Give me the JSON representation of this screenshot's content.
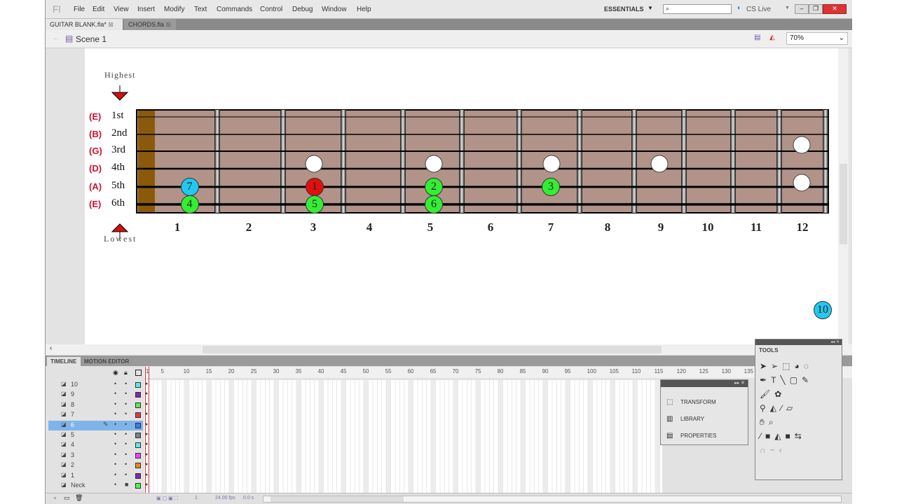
{
  "app": {
    "logo": "Fl",
    "menu": [
      "File",
      "Edit",
      "View",
      "Insert",
      "Modify",
      "Text",
      "Commands",
      "Control",
      "Debug",
      "Window",
      "Help"
    ],
    "workspace": "ESSENTIALS",
    "search_placeholder": "",
    "cs_live": "CS Live"
  },
  "tabs": [
    {
      "label": "GUITAR BLANK.fla*",
      "active": true
    },
    {
      "label": "CHORDS.fla",
      "active": false
    }
  ],
  "scene": {
    "label": "Scene 1",
    "zoom": "70%"
  },
  "fretboard": {
    "highest": "Highest",
    "lowest": "Lowest",
    "strings": [
      {
        "note": "(E)",
        "name": "1st"
      },
      {
        "note": "(B)",
        "name": "2nd"
      },
      {
        "note": "(G)",
        "name": "3rd"
      },
      {
        "note": "(D)",
        "name": "4th"
      },
      {
        "note": "(A)",
        "name": "5th"
      },
      {
        "note": "(E)",
        "name": "6th"
      }
    ],
    "fret_numbers": [
      "1",
      "2",
      "3",
      "4",
      "5",
      "6",
      "7",
      "8",
      "9",
      "10",
      "11",
      "12"
    ],
    "notes": [
      {
        "label": "7",
        "string": 5,
        "fret": 1,
        "color": "#22c8f0"
      },
      {
        "label": "4",
        "string": 6,
        "fret": 1,
        "color": "#33ee33"
      },
      {
        "label": "1",
        "string": 5,
        "fret": 3,
        "color": "#e01010"
      },
      {
        "label": "5",
        "string": 6,
        "fret": 3,
        "color": "#33ee33"
      },
      {
        "label": "2",
        "string": 5,
        "fret": 5,
        "color": "#33ee33"
      },
      {
        "label": "6",
        "string": 6,
        "fret": 5,
        "color": "#33ee33"
      },
      {
        "label": "3",
        "string": 5,
        "fret": 7,
        "color": "#33ee33"
      }
    ],
    "floating_marker": {
      "label": "10",
      "color": "#22c8f0"
    }
  },
  "timeline": {
    "tabs": [
      "TIMELINE",
      "MOTION EDITOR"
    ],
    "layers": [
      {
        "name": "10",
        "color": "#55eeee"
      },
      {
        "name": "9",
        "color": "#8822bb"
      },
      {
        "name": "8",
        "color": "#55ee55"
      },
      {
        "name": "7",
        "color": "#ee3344"
      },
      {
        "name": "6",
        "color": "#4477ee",
        "selected": true
      },
      {
        "name": "5",
        "color": "#808080"
      },
      {
        "name": "4",
        "color": "#55eeee"
      },
      {
        "name": "3",
        "color": "#ee44ee"
      },
      {
        "name": "2",
        "color": "#ee8811"
      },
      {
        "name": "1",
        "color": "#8822bb"
      },
      {
        "name": "Neck",
        "color": "#55ee55",
        "locked": true
      }
    ],
    "ruler": [
      "1",
      "5",
      "10",
      "15",
      "20",
      "25",
      "30",
      "35",
      "40",
      "45",
      "50",
      "55",
      "60",
      "65",
      "70",
      "75",
      "80",
      "85",
      "90",
      "95",
      "100",
      "105",
      "110",
      "115",
      "120",
      "125",
      "130",
      "135"
    ],
    "current_frame": "1",
    "fps": "24.00 fps",
    "time": "0.0 s"
  },
  "panels": {
    "items": [
      "TRANSFORM",
      "LIBRARY",
      "PROPERTIES"
    ],
    "tools_title": "TOOLS"
  }
}
